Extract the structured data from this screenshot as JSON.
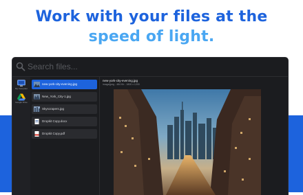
{
  "headline": {
    "line1": "Work with your files at the",
    "line2": "speed of light."
  },
  "search": {
    "placeholder": "Search files..."
  },
  "sources": [
    {
      "label": "My Computer",
      "icon": "computer-icon"
    },
    {
      "label": "Google Drive",
      "icon": "google-drive-icon"
    }
  ],
  "results": [
    {
      "name": "new-york-city-evening.jpg",
      "icon": "image-file-icon",
      "selected": true
    },
    {
      "name": "New_York_City-1.jpg",
      "icon": "image-file-icon",
      "selected": false
    },
    {
      "name": "Skyscrapers.jpg",
      "icon": "image-file-icon",
      "selected": false
    },
    {
      "name": "Dropkit Copy.docx",
      "icon": "document-file-icon",
      "selected": false
    },
    {
      "name": "Dropkit Copy.pdf",
      "icon": "pdf-file-icon",
      "selected": false
    }
  ],
  "preview": {
    "title": "new-york-city-evening.jpg",
    "meta": "image/jpeg - 484 Kb - 1800 x 1200"
  },
  "colors": {
    "brand_blue": "#1d63dd",
    "accent_light_blue": "#4aa7f2",
    "window_bg": "#1b1c1f"
  }
}
